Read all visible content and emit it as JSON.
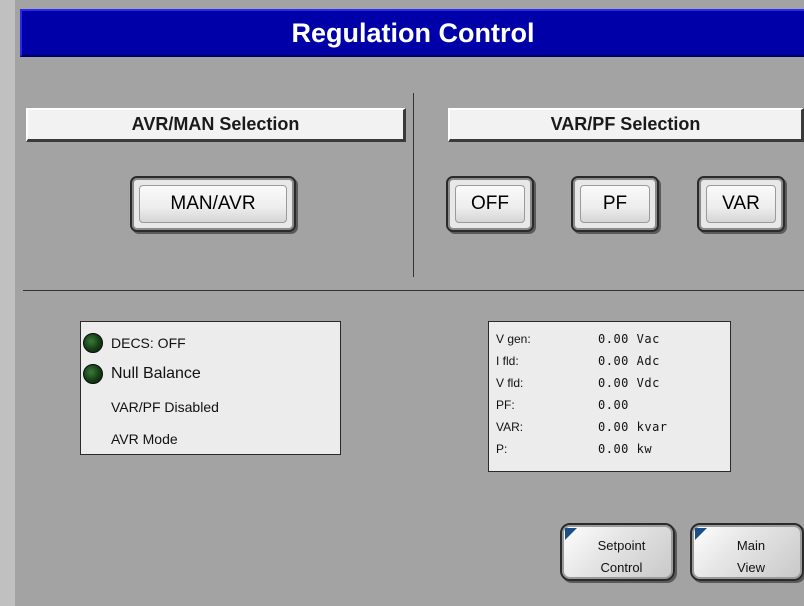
{
  "title": "Regulation Control",
  "colors": {
    "title_bar": "#0000a8",
    "background": "#a3a3a3",
    "led_off": "#1f4d1f",
    "nav_corner": "#1a4f8a"
  },
  "avr_man": {
    "header": "AVR/MAN Selection",
    "button_label": "MAN/AVR"
  },
  "var_pf": {
    "header": "VAR/PF Selection",
    "buttons": [
      "OFF",
      "PF",
      "VAR"
    ]
  },
  "status": {
    "decs": "DECS: OFF",
    "null_balance": "Null Balance",
    "var_pf_state": "VAR/PF Disabled",
    "mode": "AVR Mode",
    "led_icon": "indicator-led"
  },
  "readouts": [
    {
      "label": "V gen:",
      "value": "0.00 Vac"
    },
    {
      "label": "I fld:",
      "value": "0.00 Adc"
    },
    {
      "label": "V fld:",
      "value": "0.00 Vdc"
    },
    {
      "label": "PF:",
      "value": "0.00"
    },
    {
      "label": "VAR:",
      "value": "0.00 kvar"
    },
    {
      "label": "P:",
      "value": "0.00 kw"
    }
  ],
  "nav": {
    "setpoint_line1": "Setpoint",
    "setpoint_line2": "Control",
    "main_line1": "Main",
    "main_line2": "View"
  }
}
